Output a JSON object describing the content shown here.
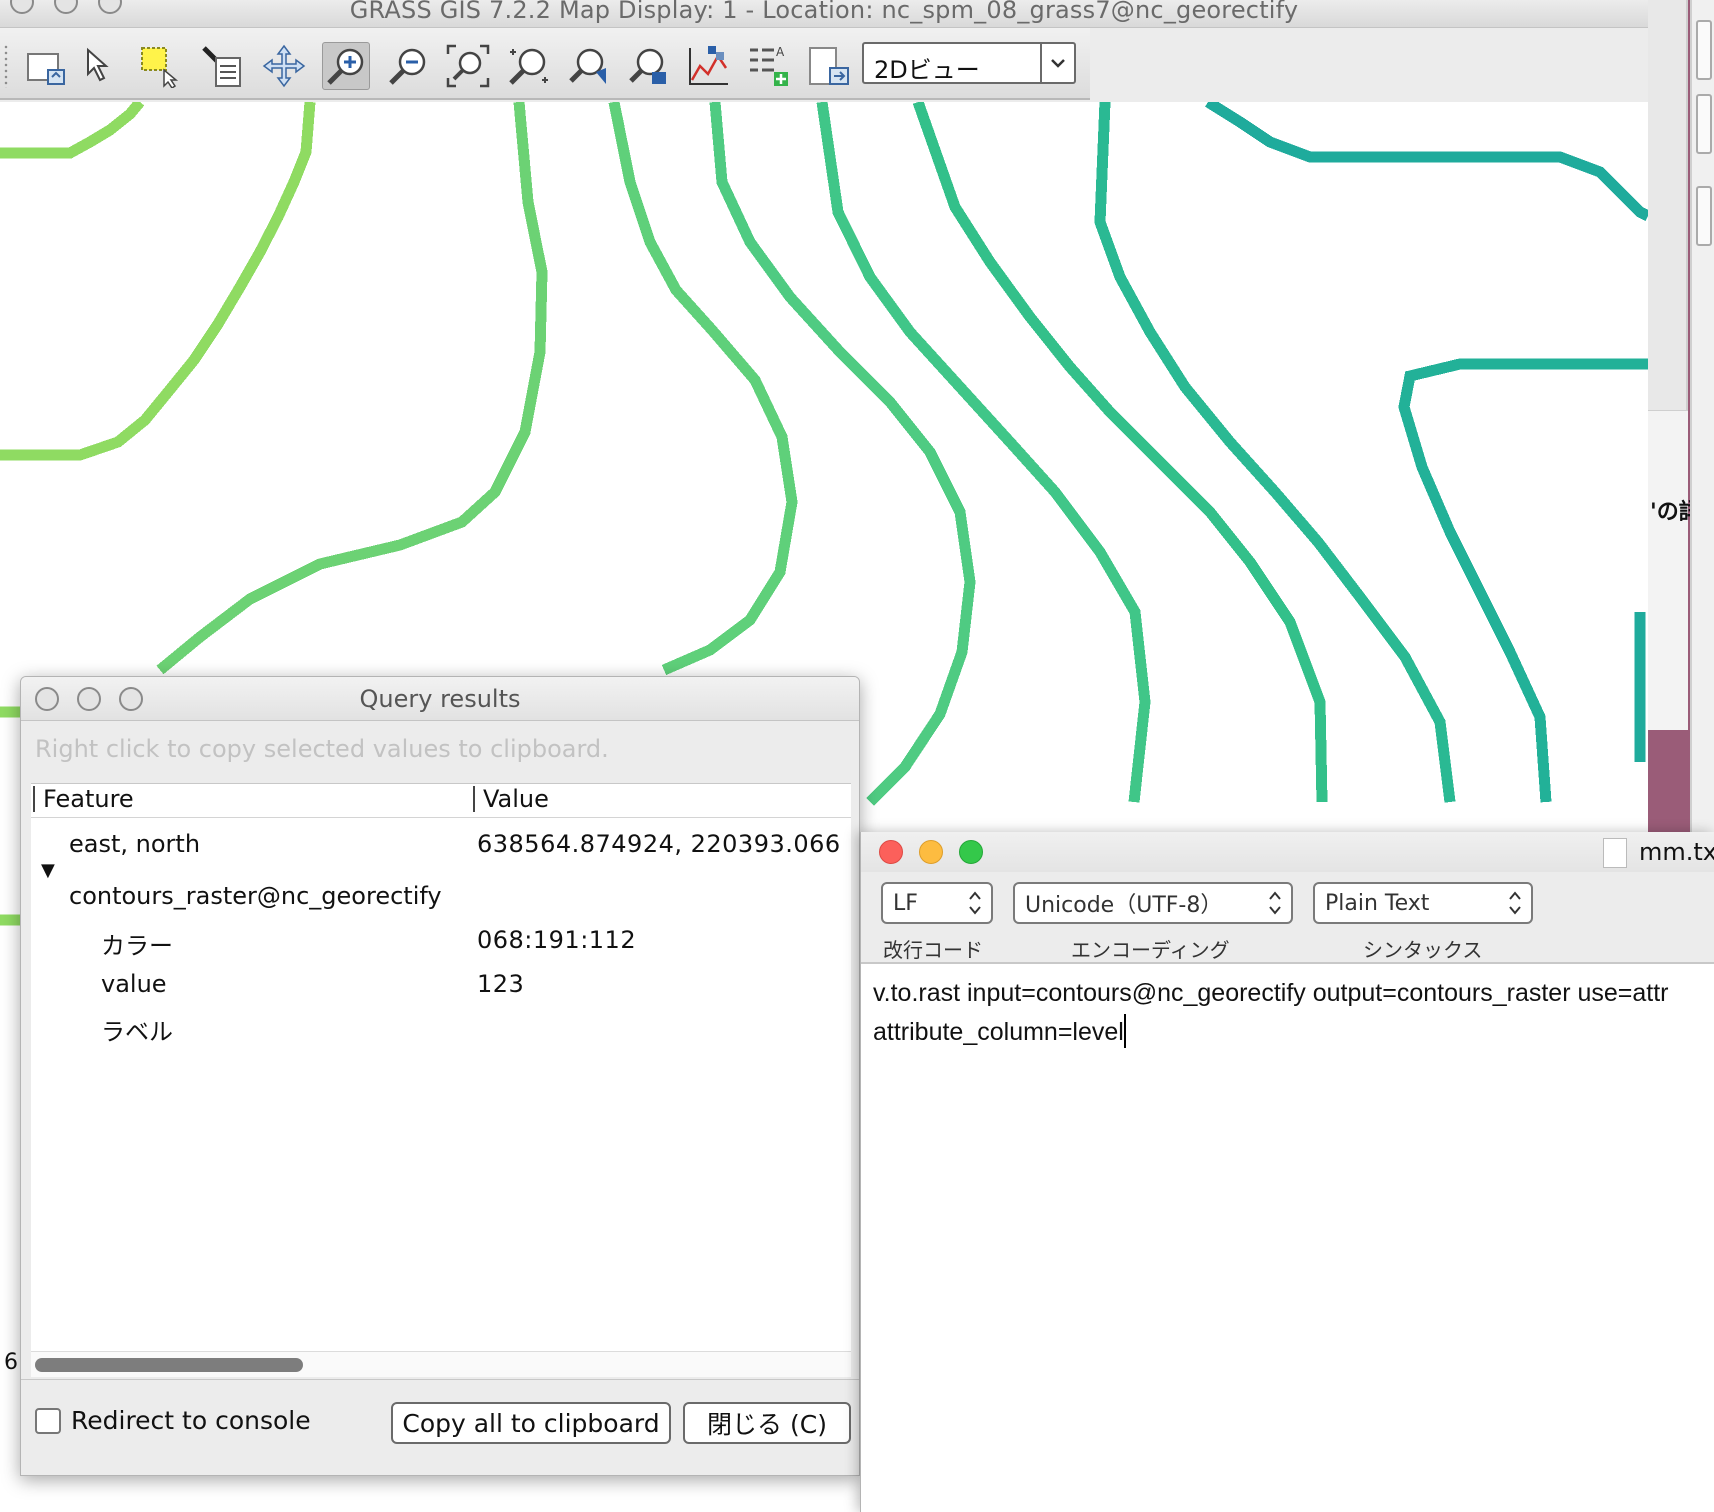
{
  "main_window": {
    "title": "GRASS GIS 7.2.2 Map Display: 1  - Location: nc_spm_08_grass7@nc_georectify"
  },
  "toolbar": {
    "view_mode": "2Dビュー",
    "tools": [
      {
        "name": "display-map-icon",
        "active": false
      },
      {
        "name": "pointer-icon",
        "active": false
      },
      {
        "name": "select-icon",
        "active": false
      },
      {
        "name": "query-icon",
        "active": false
      },
      {
        "name": "pan-icon",
        "active": false
      },
      {
        "name": "zoom-in-icon",
        "active": true
      },
      {
        "name": "zoom-out-icon",
        "active": false
      },
      {
        "name": "zoom-extent-icon",
        "active": false
      },
      {
        "name": "zoom-region-icon",
        "active": false
      },
      {
        "name": "zoom-back-icon",
        "active": false
      },
      {
        "name": "zoom-menu-icon",
        "active": false
      },
      {
        "name": "analyze-icon",
        "active": false
      },
      {
        "name": "overlay-icon",
        "active": false
      },
      {
        "name": "save-image-icon",
        "active": false
      }
    ]
  },
  "right_panel": {
    "label": "'の詳",
    "left_edge_digit": "6"
  },
  "query_dialog": {
    "title": "Query results",
    "hint": "Right click to copy selected values to clipboard.",
    "columns": {
      "feature": "Feature",
      "value": "Value"
    },
    "coords": {
      "label": "east, north",
      "value": "638564.874924, 220393.066"
    },
    "layer": {
      "name": "contours_raster@nc_georectify",
      "attributes": [
        {
          "label": "カラー",
          "value": "068:191:112"
        },
        {
          "label": "value",
          "value": "123"
        },
        {
          "label": "ラベル",
          "value": ""
        }
      ]
    },
    "redirect_label": "Redirect to console",
    "copy_button": "Copy all to clipboard",
    "close_button": "閉じる (C)"
  },
  "editor": {
    "file_name": "mm.txt",
    "line_ending": {
      "value": "LF",
      "label": "改行コード"
    },
    "encoding": {
      "value": "Unicode（UTF-8）",
      "label": "エンコーディング"
    },
    "syntax": {
      "value": "Plain Text",
      "label": "シンタックス"
    },
    "text": {
      "line1": "v.to.rast input=contours@nc_georectify output=contours_raster use=attr",
      "line2": "attribute_column=level"
    }
  },
  "colors": {
    "contour_light_green": "#8fdb62",
    "contour_green": "#5fd07a",
    "contour_teal_green": "#33c08a",
    "contour_teal": "#1fab9c",
    "close_red": "#fc605b",
    "minimize_yellow": "#fdbc40",
    "zoom_green": "#34c84a"
  }
}
